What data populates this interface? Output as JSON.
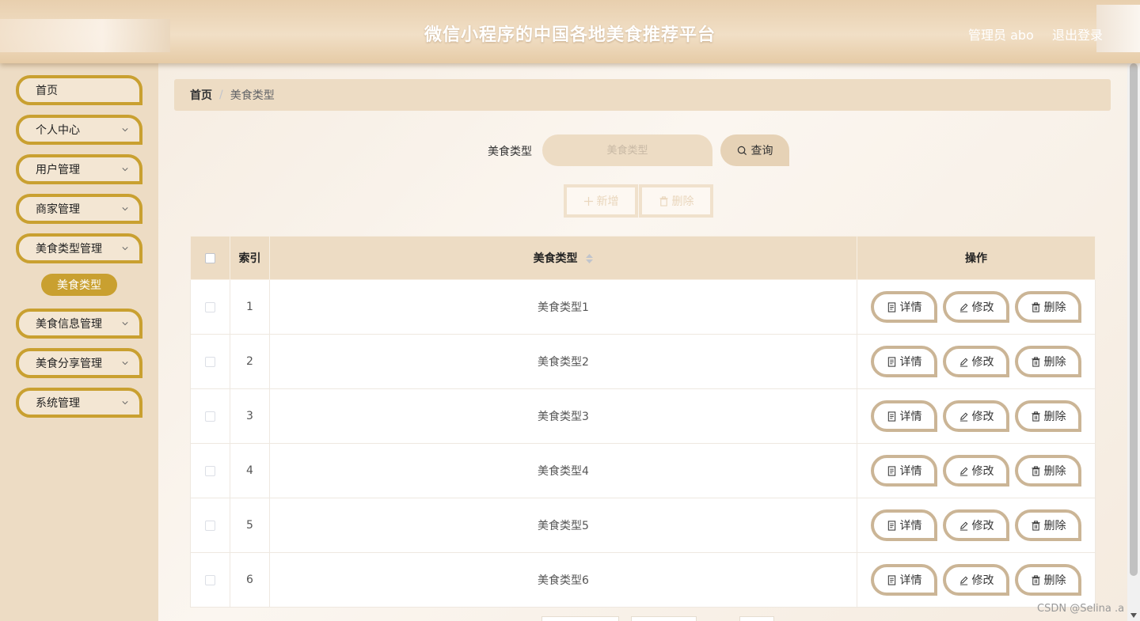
{
  "header": {
    "title": "微信小程序的中国各地美食推荐平台",
    "user_label": "管理员 abo",
    "logout_label": "退出登录"
  },
  "sidebar": {
    "items": [
      {
        "label": "首页",
        "has_children": false
      },
      {
        "label": "个人中心",
        "has_children": true
      },
      {
        "label": "用户管理",
        "has_children": true
      },
      {
        "label": "商家管理",
        "has_children": true
      },
      {
        "label": "美食类型管理",
        "has_children": true
      },
      {
        "label": "美食信息管理",
        "has_children": true
      },
      {
        "label": "美食分享管理",
        "has_children": true
      },
      {
        "label": "系统管理",
        "has_children": true
      }
    ],
    "active_sub_item": "美食类型"
  },
  "breadcrumb": {
    "home": "首页",
    "separator": "/",
    "current": "美食类型"
  },
  "search": {
    "label": "美食类型",
    "placeholder": "美食类型",
    "button_label": "查询"
  },
  "toolbar": {
    "add_label": "新增",
    "delete_label": "删除"
  },
  "table": {
    "columns": [
      "索引",
      "美食类型",
      "操作"
    ],
    "rows": [
      {
        "index": "1",
        "type": "美食类型1"
      },
      {
        "index": "2",
        "type": "美食类型2"
      },
      {
        "index": "3",
        "type": "美食类型3"
      },
      {
        "index": "4",
        "type": "美食类型4"
      },
      {
        "index": "5",
        "type": "美食类型5"
      },
      {
        "index": "6",
        "type": "美食类型6"
      }
    ],
    "row_actions": {
      "detail": "详情",
      "edit": "修改",
      "delete": "删除"
    }
  },
  "watermark": "CSDN @Selina .a",
  "colors": {
    "accent": "#c9a030",
    "panel": "#eddcc4",
    "button_border": "#cbb596"
  }
}
